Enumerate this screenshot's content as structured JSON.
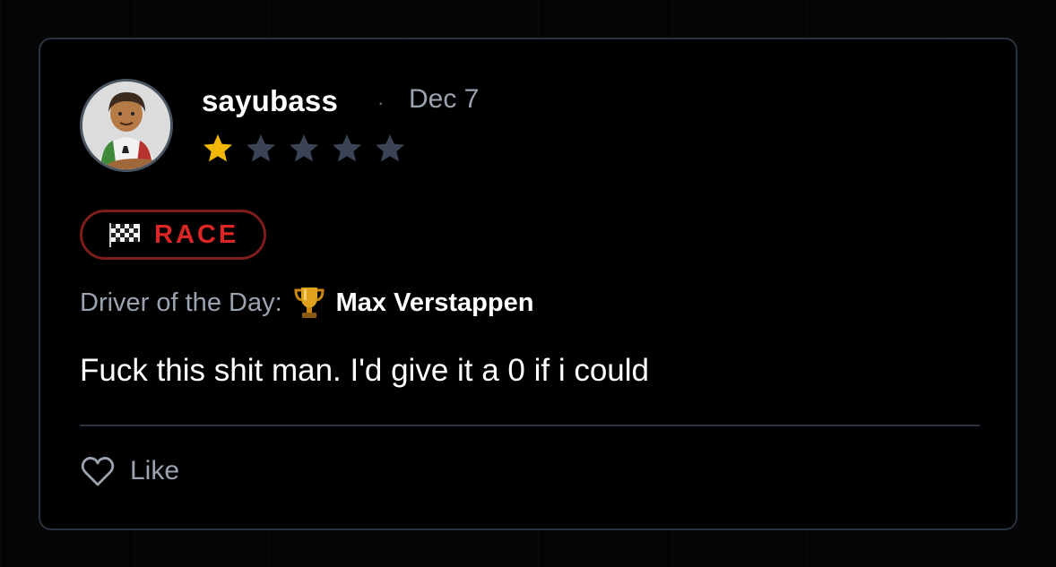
{
  "review": {
    "username": "sayubass",
    "separator": "·",
    "date": "Dec 7",
    "rating": 1,
    "rating_max": 5,
    "star_filled_color": "#f2b705",
    "star_empty_color": "#3a4454",
    "session_badge": {
      "icon": "checkered-flag-icon",
      "label": "RACE",
      "color": "#dc2626"
    },
    "driver_of_the_day": {
      "label": "Driver of the Day:",
      "icon": "trophy-icon",
      "name": "Max Verstappen"
    },
    "comment": "Fuck this shit man. I'd give it a 0 if i could",
    "like": {
      "icon": "heart-icon",
      "label": "Like"
    }
  }
}
